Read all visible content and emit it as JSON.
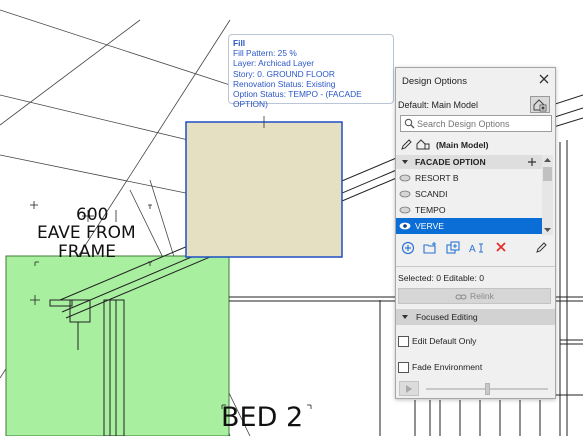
{
  "drawing": {
    "dimension": "600",
    "label_line1": "EAVE FROM",
    "label_line2": "FRAME",
    "room_label": "BED 2"
  },
  "tooltip": {
    "title": "Fill",
    "lines": [
      "Fill Pattern: 25 %",
      "Layer: Archicad Layer",
      "Story: 0. GROUND FLOOR",
      "Renovation Status: Existing",
      "Option Status: TEMPO -  (FACADE OPTION)"
    ]
  },
  "panel": {
    "title": "Design Options",
    "close_icon": "close-icon",
    "default_label": "Default: Main Model",
    "search_placeholder": "Search Design Options",
    "main_model": "(Main Model)",
    "option_set": "FACADE OPTION",
    "options": [
      {
        "label": "RESORT B",
        "selected": false
      },
      {
        "label": "SCANDI",
        "selected": false
      },
      {
        "label": "TEMPO",
        "selected": false
      },
      {
        "label": "VERVE",
        "selected": true
      }
    ],
    "selected_info": "Selected: 0 Editable: 0",
    "relink_label": "Relink",
    "focused_header": "Focused Editing",
    "edit_default_only": "Edit Default Only",
    "fade_environment": "Fade Environment",
    "fade_level": 0.5,
    "colors": {
      "selection": "#0b6ed6",
      "delete": "#e0322b",
      "tool_blue": "#2a74d4",
      "tooltip_text": "#2a56c6",
      "fill_tan": "#e6e0c2",
      "fill_green": "#a8f0a0"
    }
  }
}
